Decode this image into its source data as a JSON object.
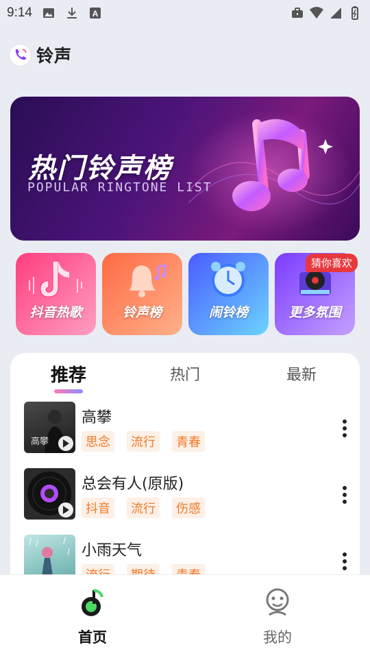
{
  "status_bar": {
    "time": "9:14"
  },
  "header": {
    "title": "铃声"
  },
  "banner": {
    "title": "热门铃声榜",
    "subtitle": "POPULAR RINGTONE LIST"
  },
  "categories": [
    {
      "label": "抖音热歌",
      "color_from": "#ff3d7f",
      "color_to": "#ff87b3"
    },
    {
      "label": "铃声榜",
      "color_from": "#ff6b45",
      "color_to": "#ffa27a"
    },
    {
      "label": "闹铃榜",
      "color_from": "#4a5cff",
      "color_to": "#62b8ff"
    },
    {
      "label": "更多氛围",
      "color_from": "#7a3cff",
      "color_to": "#b98bff"
    }
  ],
  "category_badge": "猜你喜欢",
  "tabs": [
    {
      "label": "推荐",
      "active": true
    },
    {
      "label": "热门",
      "active": false
    },
    {
      "label": "最新",
      "active": false
    }
  ],
  "songs": [
    {
      "title": "高攀",
      "tags": [
        "思念",
        "流行",
        "青春"
      ]
    },
    {
      "title": "总会有人(原版)",
      "tags": [
        "抖音",
        "流行",
        "伤感"
      ]
    },
    {
      "title": "小雨天气",
      "tags": [
        "流行",
        "期待",
        "青春"
      ]
    }
  ],
  "bottom_nav": [
    {
      "label": "首页",
      "active": true,
      "icon": "music-note-icon"
    },
    {
      "label": "我的",
      "active": false,
      "icon": "profile-icon"
    }
  ],
  "colors": {
    "accent": "#f07a2a",
    "tag_bg": "#fdf0e6",
    "nav_active": "#111111",
    "nav_inactive": "#666666"
  }
}
